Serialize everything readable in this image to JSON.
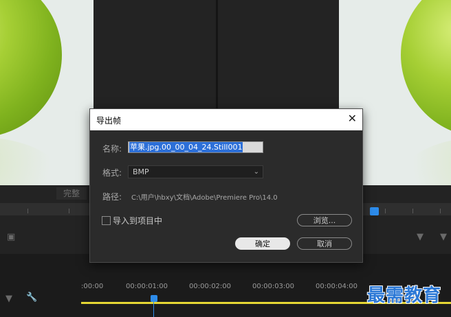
{
  "timeline": {
    "zoom_label": "完整",
    "timecodes": [
      ":00:00",
      "00:00:01:00",
      "00:00:02:00",
      "00:00:03:00",
      "00:00:04:00"
    ]
  },
  "watermark": "最需教育",
  "dialog": {
    "title": "导出帧",
    "name_label": "名称:",
    "name_value": "苹果.jpg.00_00_04_24.Still001",
    "format_label": "格式:",
    "format_value": "BMP",
    "path_label": "路径:",
    "path_value": "C:\\用户\\hbxy\\文档\\Adobe\\Premiere Pro\\14.0",
    "import_checkbox_label": "导入到项目中",
    "browse_label": "浏览...",
    "ok_label": "确定",
    "cancel_label": "取消"
  },
  "colors": {
    "accent": "#2d8ceb",
    "timeline_bar": "#e5d634",
    "selection": "#2c6fd8"
  },
  "icons": [
    "camera-icon",
    "wrench-icon",
    "marker-icon",
    "close-icon",
    "chevron-down-icon"
  ]
}
